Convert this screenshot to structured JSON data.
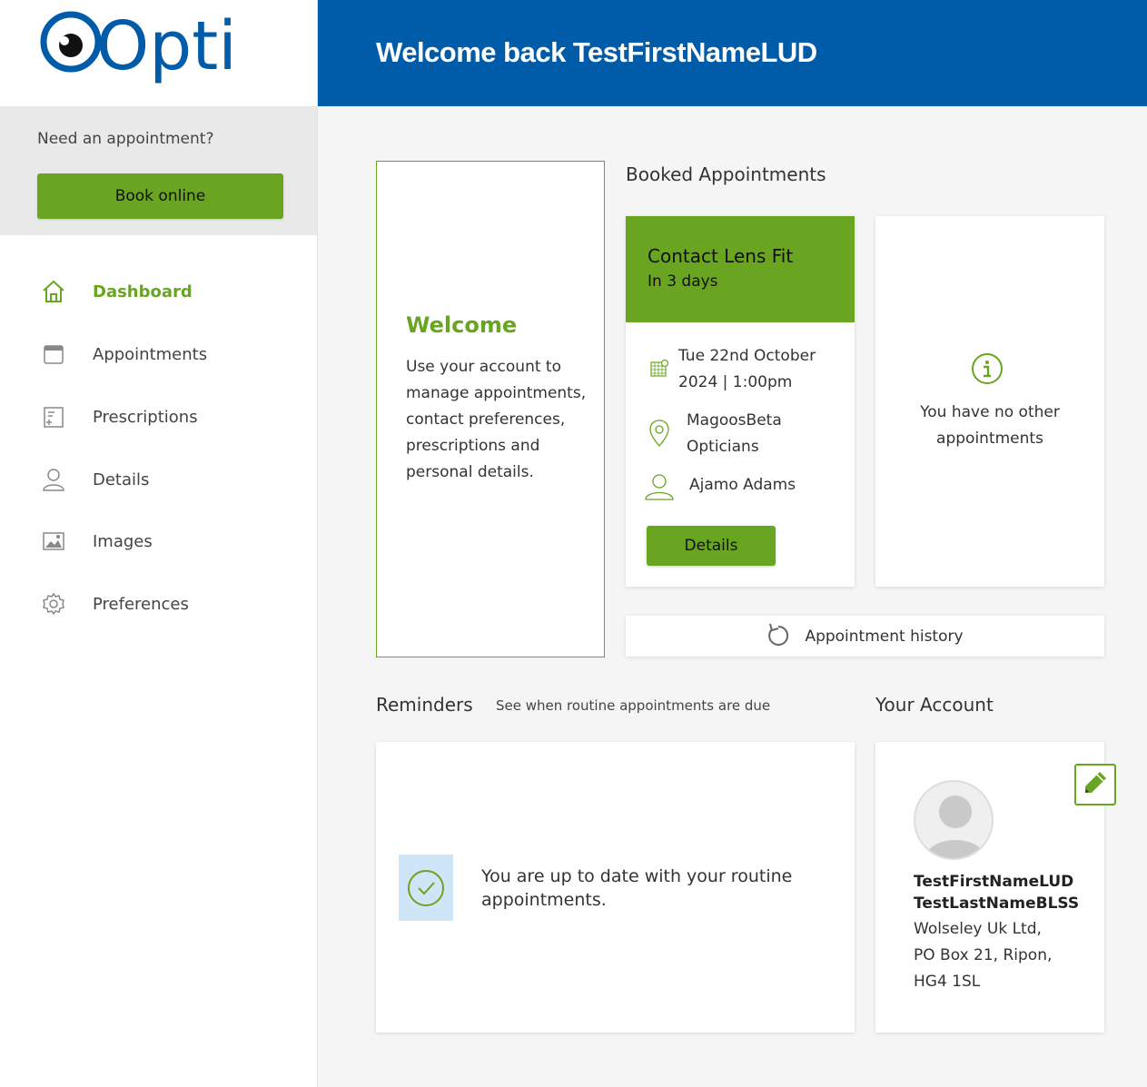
{
  "brand": {
    "logo_text": "Optix",
    "primary_color": "#005ca9",
    "accent_color": "#69a520"
  },
  "sidebar": {
    "prompt": "Need an appointment?",
    "book_label": "Book online",
    "items": [
      {
        "label": "Dashboard",
        "icon": "home-icon",
        "active": true
      },
      {
        "label": "Appointments",
        "icon": "calendar-icon"
      },
      {
        "label": "Prescriptions",
        "icon": "prescription-icon"
      },
      {
        "label": "Details",
        "icon": "user-icon"
      },
      {
        "label": "Images",
        "icon": "image-icon"
      },
      {
        "label": "Preferences",
        "icon": "gear-icon"
      }
    ]
  },
  "header": {
    "title": "Welcome back TestFirstNameLUD"
  },
  "welcome": {
    "title": "Welcome",
    "text": "Use your account to manage appointments, contact preferences, prescriptions and personal details."
  },
  "booked": {
    "title": "Booked Appointments",
    "appointment": {
      "type": "Contact Lens Fit",
      "relative": "In 3 days",
      "date_line1": "Tue 22nd October",
      "date_line2": "2024 | 1:00pm",
      "location_line1": "MagoosBeta",
      "location_line2": "Opticians",
      "practitioner": "Ajamo Adams",
      "details_label": "Details"
    },
    "no_other": "You have no other appointments",
    "history_label": "Appointment history"
  },
  "reminders": {
    "title": "Reminders",
    "subtitle": "See when routine appointments are due",
    "status": "You are up to date with your routine appointments."
  },
  "account": {
    "title": "Your Account",
    "first_name": "TestFirstNameLUD",
    "last_name": "TestLastNameBLSS",
    "address_line1": "Wolseley Uk Ltd,",
    "address_line2": "PO Box 21, Ripon,",
    "address_line3": "HG4 1SL"
  }
}
